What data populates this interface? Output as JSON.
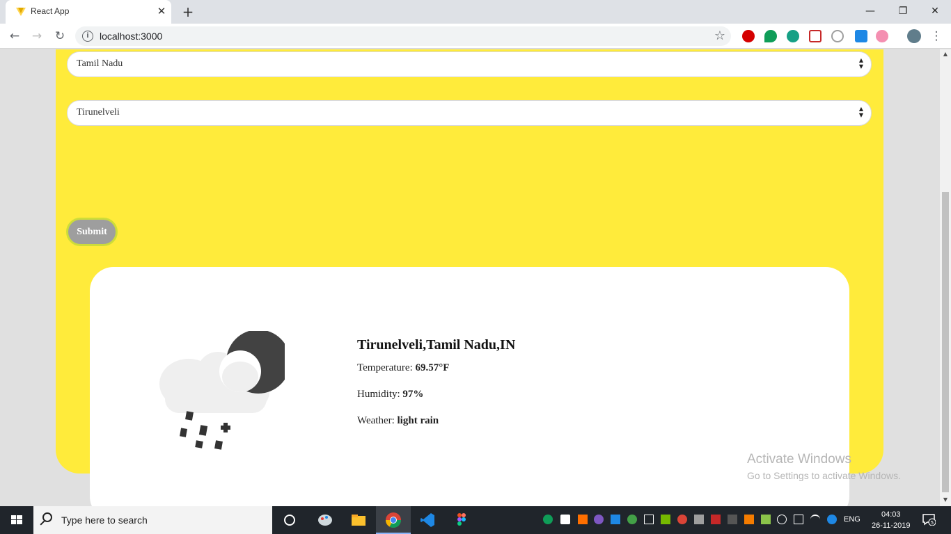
{
  "browser": {
    "tab_title": "React App",
    "tab_close": "✕",
    "new_tab": "+",
    "url": "localhost:3000",
    "win_minimize": "—",
    "win_restore": "❐",
    "win_close": "✕"
  },
  "form": {
    "state_value": "Tamil Nadu",
    "city_value": "Tirunelveli",
    "submit_label": "Submit"
  },
  "weather": {
    "location": "Tirunelveli,Tamil Nadu,IN",
    "temperature_label": "Temperature:",
    "temperature_value": "69.57°F",
    "humidity_label": "Humidity:",
    "humidity_value": "97%",
    "weather_label": "Weather:",
    "weather_value": "light rain",
    "icon": "night-cloud-rain-icon"
  },
  "watermark": {
    "line1": "Activate Windows",
    "line2": "Go to Settings to activate Windows."
  },
  "taskbar": {
    "search_placeholder": "Type here to search",
    "language": "ENG",
    "time": "04:03",
    "date": "26-11-2019",
    "notification_count": "5"
  },
  "colors": {
    "card_yellow": "#ffeb3b",
    "submit_gray": "#9e9e9e",
    "submit_border": "#cddc39"
  }
}
